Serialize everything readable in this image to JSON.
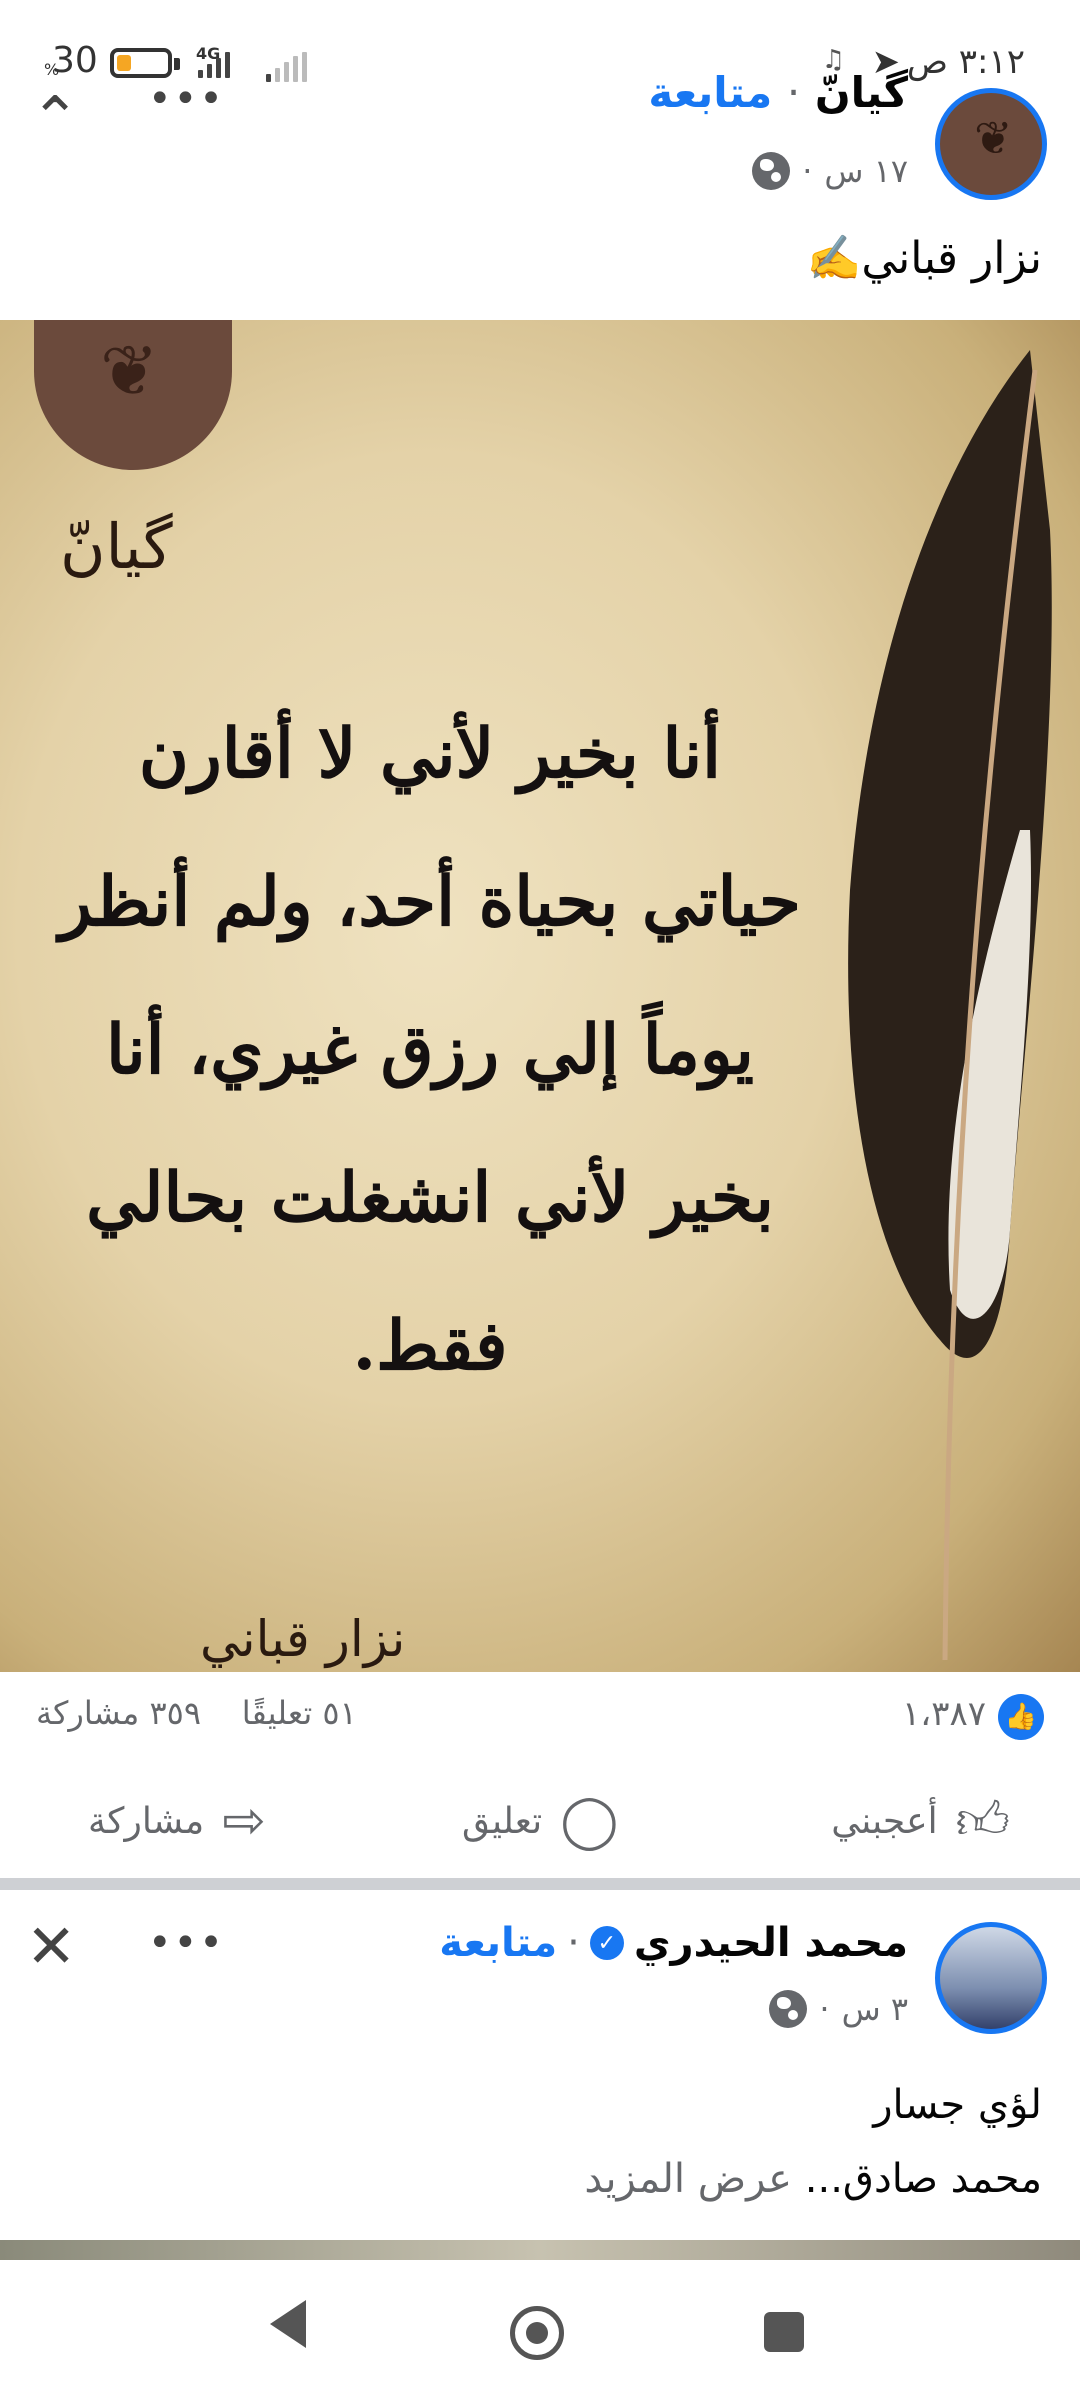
{
  "status_bar": {
    "time": "٣:١٢ ص",
    "battery_percent": "30",
    "battery_sign": "%",
    "network": "4G",
    "battery_level": 0.3
  },
  "post1": {
    "author": "گيانّ",
    "follow_label": "متابعة",
    "separator": "·",
    "time": "١٧ س",
    "caption": "نزار قباني✍️",
    "image": {
      "signature": "گيانّ",
      "quote_lines": [
        "أنا بخير لأني لا أقارن",
        "حياتي بحياة أحد، ولم أنظر",
        "يوماً إلي رزق غيري، أنا",
        "بخير لأني انشغلت بحالي",
        "فقط."
      ],
      "author_mark": "نزار قباني"
    },
    "like_count": "١،٣٨٧",
    "comments": "٥١ تعليقًا",
    "shares": "٣٥٩ مشاركة",
    "actions": {
      "like": "أعجبني",
      "comment": "تعليق",
      "share": "مشاركة"
    }
  },
  "post2": {
    "author": "محمد الحيدري",
    "follow_label": "متابعة",
    "separator": "·",
    "time": "٣ س",
    "line1": "لؤي جسار",
    "line2": "محمد صادق...",
    "see_more": "عرض المزيد"
  },
  "icons": {
    "like": "thumbs-up-icon",
    "comment": "speech-bubble-icon",
    "share": "share-arrow-icon",
    "globe": "globe-icon",
    "close": "close-icon",
    "more": "more-dots-icon"
  },
  "colors": {
    "accent": "#1877f2",
    "secondary_text": "#65676b",
    "divider": "#ced0d4"
  }
}
